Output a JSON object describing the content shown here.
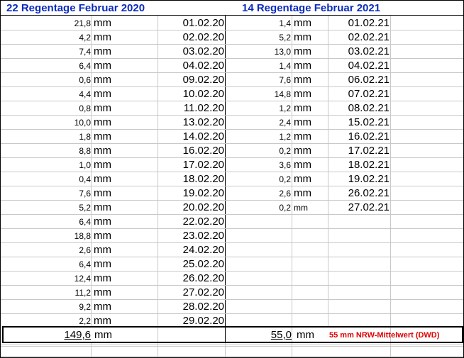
{
  "headers": {
    "left": "22 Regentage Februar 2020",
    "right": "14 Regentage Februar 2021"
  },
  "unit": "mm",
  "rows_2020": [
    {
      "value": "21,8",
      "date": "01.02.20"
    },
    {
      "value": "4,2",
      "date": "02.02.20"
    },
    {
      "value": "7,4",
      "date": "03.02.20"
    },
    {
      "value": "6,4",
      "date": "04.02.20"
    },
    {
      "value": "0,6",
      "date": "09.02.20"
    },
    {
      "value": "4,4",
      "date": "10.02.20"
    },
    {
      "value": "0,8",
      "date": "11.02.20"
    },
    {
      "value": "10,0",
      "date": "13.02.20"
    },
    {
      "value": "1,8",
      "date": "14.02.20"
    },
    {
      "value": "8,8",
      "date": "16.02.20"
    },
    {
      "value": "1,0",
      "date": "17.02.20"
    },
    {
      "value": "0,4",
      "date": "18.02.20"
    },
    {
      "value": "7,6",
      "date": "19.02.20"
    },
    {
      "value": "5,2",
      "date": "20.02.20"
    },
    {
      "value": "6,4",
      "date": "22.02.20"
    },
    {
      "value": "18,8",
      "date": "23.02.20"
    },
    {
      "value": "2,6",
      "date": "24.02.20"
    },
    {
      "value": "6,4",
      "date": "25.02.20"
    },
    {
      "value": "12,4",
      "date": "26.02.20"
    },
    {
      "value": "11,2",
      "date": "27.02.20"
    },
    {
      "value": "9,2",
      "date": "28.02.20"
    },
    {
      "value": "2,2",
      "date": "29.02.20"
    }
  ],
  "rows_2021": [
    {
      "value": "1,4",
      "date": "01.02.21"
    },
    {
      "value": "5,2",
      "date": "02.02.21"
    },
    {
      "value": "13,0",
      "date": "03.02.21"
    },
    {
      "value": "1,4",
      "date": "04.02.21"
    },
    {
      "value": "7,6",
      "date": "06.02.21"
    },
    {
      "value": "14,8",
      "date": "07.02.21"
    },
    {
      "value": "1,2",
      "date": "08.02.21"
    },
    {
      "value": "2,4",
      "date": "15.02.21"
    },
    {
      "value": "1,2",
      "date": "16.02.21"
    },
    {
      "value": "0,2",
      "date": "17.02.21"
    },
    {
      "value": "3,6",
      "date": "18.02.21"
    },
    {
      "value": "0,2",
      "date": "19.02.21"
    },
    {
      "value": "2,6",
      "date": "26.02.21"
    },
    {
      "value": "0,2",
      "date": "27.02.21"
    }
  ],
  "totals": {
    "left": "149,6",
    "right": "55,0",
    "note": "55 mm NRW-Mittelwert (DWD)"
  },
  "colors": {
    "header_text": "#0a2bbd",
    "note_text": "#e00000",
    "gridline": "#c8c8c8"
  }
}
